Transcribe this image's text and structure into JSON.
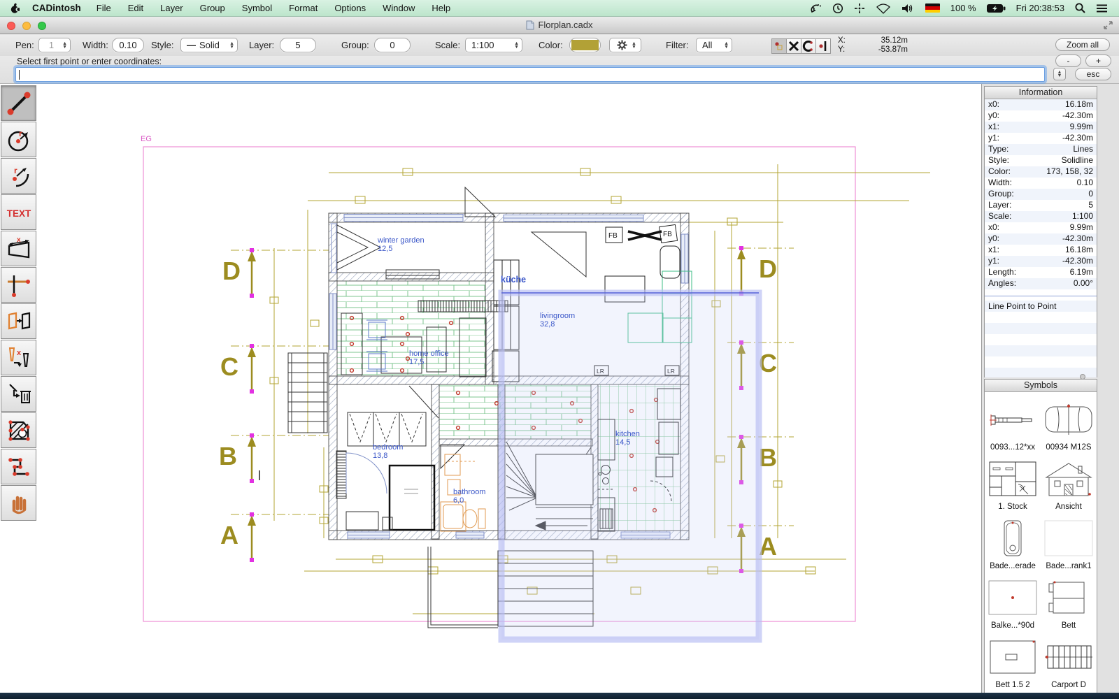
{
  "menu_bar": {
    "app_name": "CADintosh",
    "items": [
      "File",
      "Edit",
      "Layer",
      "Group",
      "Symbol",
      "Format",
      "Options",
      "Window",
      "Help"
    ],
    "status": {
      "battery_label": "100 %",
      "clock": "Fri 20:38:53"
    }
  },
  "window": {
    "title": "Florplan.cadx"
  },
  "toolbar": {
    "pen_label": "Pen:",
    "pen_value": "1",
    "width_label": "Width:",
    "width_value": "0.10",
    "style_label": "Style:",
    "style_dash": "—",
    "style_value": "Solid",
    "layer_label": "Layer:",
    "layer_value": "5",
    "group_label": "Group:",
    "group_value": "0",
    "scale_label": "Scale:",
    "scale_value": "1:100",
    "color_label": "Color:",
    "color_swatch": "#b2a136",
    "filter_label": "Filter:",
    "filter_value": "All",
    "x_label": "X:",
    "x_value": "35.12m",
    "y_label": "Y:",
    "y_value": "-53.87m",
    "zoom_all_label": "Zoom all",
    "minus_label": "-",
    "plus_label": "+",
    "esc_label": "esc"
  },
  "prompt": {
    "label": "Select first point or enter coordinates:",
    "input_value": ""
  },
  "palette": {
    "tools": [
      "line-tool",
      "circle-radius-tool",
      "arc-radius-tool",
      "text-tool",
      "dimension-tool",
      "ortho-point-tool",
      "copy-symbol-tool",
      "modify-pen-tool",
      "delete-tool",
      "hatch-tool",
      "polyline-tool",
      "pan-hand-tool"
    ]
  },
  "canvas": {
    "page_label": "EG",
    "grid_letters": [
      "D",
      "C",
      "B",
      "A"
    ],
    "markers": {
      "fb": "FB",
      "lr": "LR"
    },
    "rooms": [
      {
        "name": "winter garden",
        "area": "12,5"
      },
      {
        "name": "küche",
        "area": ""
      },
      {
        "name": "livingroom",
        "area": "32,8"
      },
      {
        "name": "home office",
        "area": "17,5"
      },
      {
        "name": "bedroom",
        "area": "13,8"
      },
      {
        "name": "bathroom",
        "area": "6,0"
      },
      {
        "name": "kitchen",
        "area": "14,5"
      }
    ]
  },
  "info_panel": {
    "title": "Information",
    "rows": [
      {
        "label": "x0:",
        "value": "16.18m"
      },
      {
        "label": "y0:",
        "value": "-42.30m"
      },
      {
        "label": "x1:",
        "value": "9.99m"
      },
      {
        "label": "y1:",
        "value": "-42.30m"
      },
      {
        "label": "Type:",
        "value": "Lines"
      },
      {
        "label": "Style:",
        "value": "Solidline"
      },
      {
        "label": "Color:",
        "value": "173, 158, 32"
      },
      {
        "label": "Width:",
        "value": "0.10"
      },
      {
        "label": "Group:",
        "value": "0"
      },
      {
        "label": "Layer:",
        "value": "5"
      },
      {
        "label": "Scale:",
        "value": "1:100"
      },
      {
        "label": "x0:",
        "value": "9.99m"
      },
      {
        "label": "y0:",
        "value": "-42.30m"
      },
      {
        "label": "x1:",
        "value": "16.18m"
      },
      {
        "label": "y1:",
        "value": "-42.30m"
      },
      {
        "label": "Length:",
        "value": "6.19m"
      },
      {
        "label": "Angles:",
        "value": "0.00°"
      }
    ],
    "footer": "Line Point to Point"
  },
  "symbols_panel": {
    "title": "Symbols",
    "items": [
      {
        "label": "0093...12*xx"
      },
      {
        "label": "00934 M12S"
      },
      {
        "label": "1. Stock"
      },
      {
        "label": "Ansicht"
      },
      {
        "label": "Bade...erade"
      },
      {
        "label": "Bade...rank1"
      },
      {
        "label": "Balke...*90d"
      },
      {
        "label": "Bett"
      },
      {
        "label": "Bett  1.5  2"
      },
      {
        "label": "Carport D"
      }
    ]
  }
}
